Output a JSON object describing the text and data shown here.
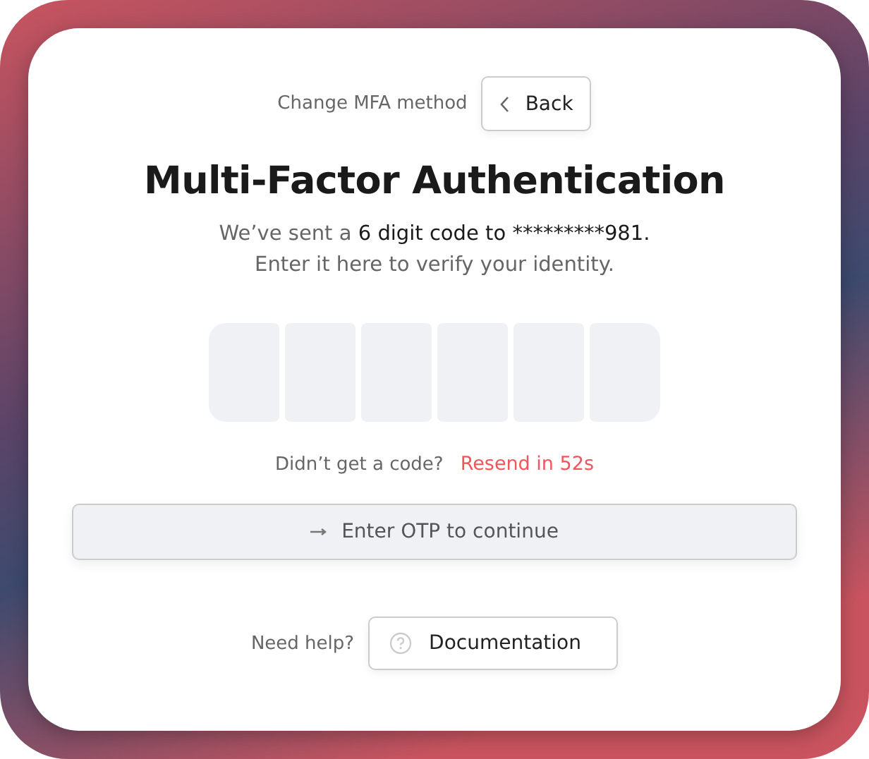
{
  "header": {
    "label": "Change MFA method",
    "back_button": "Back"
  },
  "title": "Multi-Factor Authentication",
  "message": {
    "lead": "We’ve sent a ",
    "emphasis": "6 digit code to *********981.",
    "line_2": "Enter it here to verify your identity."
  },
  "otp_boxes": [
    {
      "filled": false
    },
    {
      "filled": false
    },
    {
      "filled": false
    },
    {
      "filled": false
    },
    {
      "filled": false
    },
    {
      "filled": false
    }
  ],
  "resend": {
    "prompt": "Didn’t get a code?",
    "link": "Resend in 52s"
  },
  "continue_button": {
    "label": "Enter OTP to continue",
    "disabled": true
  },
  "help": {
    "prompt": "Need help?",
    "button": "Documentation"
  }
}
